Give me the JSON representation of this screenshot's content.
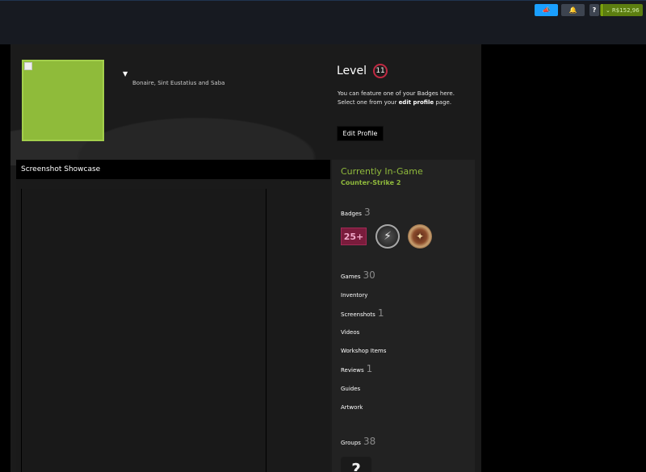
{
  "header": {
    "announce_icon": "megaphone-icon",
    "notify_icon": "bell-icon",
    "help_label": "?",
    "wallet_label": "R$152,96"
  },
  "profile": {
    "location": "Bonaire, Sint Eustatius and Saba",
    "level_label": "Level",
    "level_value": "11",
    "level_help_prefix": "You can feature one of your Badges here. Select one from your ",
    "level_help_link": "edit profile",
    "level_help_suffix": " page.",
    "edit_profile_label": "Edit Profile"
  },
  "showcase": {
    "title": "Screenshot Showcase"
  },
  "sidebar": {
    "ingame_title": "Currently In-Game",
    "ingame_game": "Counter-Strike 2",
    "badges_label": "Badges",
    "badges_count": "3",
    "badge_25_label": "25+",
    "games_label": "Games",
    "games_count": "30",
    "inventory_label": "Inventory",
    "screenshots_label": "Screenshots",
    "screenshots_count": "1",
    "videos_label": "Videos",
    "workshop_label": "Workshop Items",
    "reviews_label": "Reviews",
    "reviews_count": "1",
    "guides_label": "Guides",
    "artwork_label": "Artwork",
    "groups_label": "Groups",
    "groups_count": "38",
    "group_avatar_text": "?"
  },
  "colors": {
    "ingame_green": "#90ba3c",
    "level_ring": "#c02942",
    "announce_blue": "#1a9fff",
    "wallet_green": "#5c7e10"
  }
}
